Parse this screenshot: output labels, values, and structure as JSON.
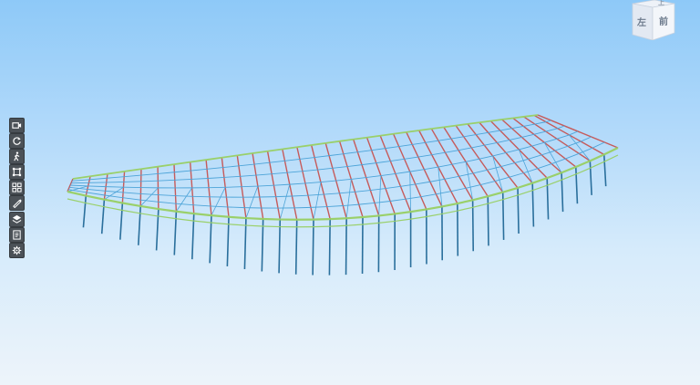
{
  "viewer": {
    "background_top": "#8ec9f8",
    "background_bottom": "#edf4fa",
    "model_colors": {
      "column": "#2a6f9c",
      "chord": "#9ad06a",
      "rafter": "#c65a5a",
      "bracing": "#4da4d8"
    }
  },
  "toolbar": {
    "tools": [
      {
        "icon": "camera-icon"
      },
      {
        "icon": "rotate-icon"
      },
      {
        "icon": "walk-icon"
      },
      {
        "icon": "fit-view-icon"
      },
      {
        "icon": "model-tree-icon"
      },
      {
        "icon": "measure-icon"
      },
      {
        "icon": "section-icon"
      },
      {
        "icon": "properties-icon"
      },
      {
        "icon": "settings-icon"
      }
    ]
  },
  "navcube": {
    "left_face": "左",
    "front_face": "前",
    "top_face": "上"
  }
}
